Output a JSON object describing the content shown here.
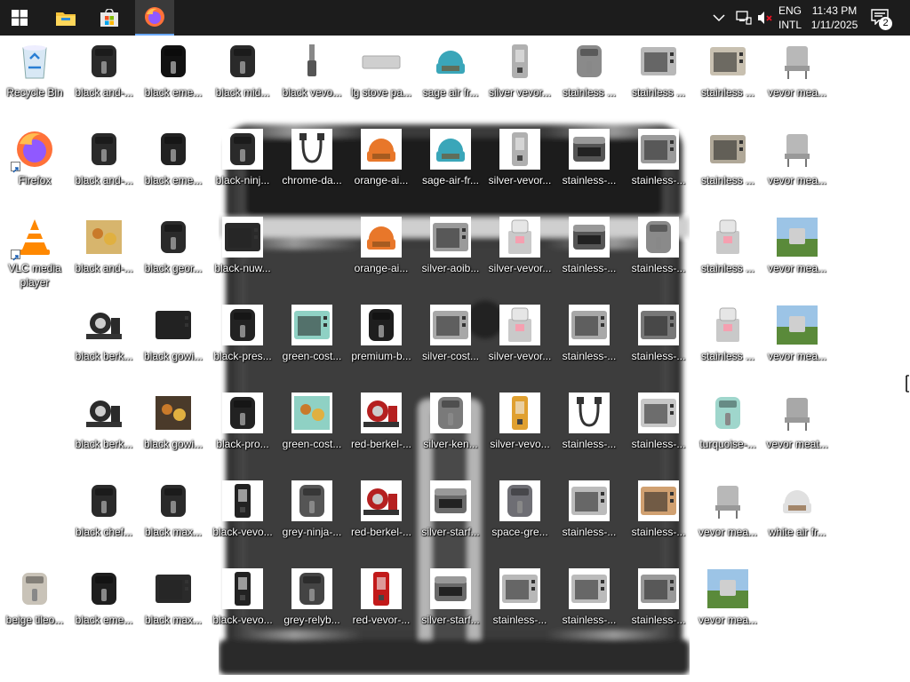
{
  "taskbar": {
    "apps": [
      "start-icon",
      "file-explorer-icon",
      "microsoft-store-icon",
      "firefox-icon"
    ],
    "tray": {
      "lang_top": "ENG",
      "lang_bottom": "INTL",
      "time": "11:43 PM",
      "date": "1/11/2025",
      "notification_count": "2"
    }
  },
  "desktop": {
    "icons": [
      {
        "label": "Recycle Bin",
        "col": 0,
        "row": 0,
        "kind": "bin"
      },
      {
        "label": "Firefox",
        "col": 0,
        "row": 1,
        "kind": "firefox"
      },
      {
        "label": "VLC media player",
        "col": 0,
        "row": 2,
        "kind": "vlc"
      },
      {
        "label": "beige tileo...",
        "col": 0,
        "row": 6,
        "kind": "fryer",
        "color": "#c9c3b8"
      },
      {
        "label": "black and-...",
        "col": 1,
        "row": 0,
        "kind": "fryer",
        "color": "#2a2a2a"
      },
      {
        "label": "black and-...",
        "col": 1,
        "row": 1,
        "kind": "fryer",
        "color": "#2a2a2a"
      },
      {
        "label": "black and-...",
        "col": 1,
        "row": 2,
        "kind": "food",
        "color": "#d7b56d"
      },
      {
        "label": "black berk...",
        "col": 1,
        "row": 3,
        "kind": "slicer",
        "color": "#2a2a2a"
      },
      {
        "label": "black berk...",
        "col": 1,
        "row": 4,
        "kind": "slicer",
        "color": "#2a2a2a"
      },
      {
        "label": "black chef...",
        "col": 1,
        "row": 5,
        "kind": "fryer",
        "color": "#2a2a2a"
      },
      {
        "label": "black eme...",
        "col": 1,
        "row": 6,
        "kind": "fryer",
        "color": "#1e1e1e"
      },
      {
        "label": "black eme...",
        "col": 2,
        "row": 0,
        "kind": "fryer",
        "color": "#111111"
      },
      {
        "label": "black eme...",
        "col": 2,
        "row": 1,
        "kind": "fryer",
        "color": "#222222"
      },
      {
        "label": "black geor...",
        "col": 2,
        "row": 2,
        "kind": "fryer",
        "color": "#2a2a2a"
      },
      {
        "label": "black gowi...",
        "col": 2,
        "row": 3,
        "kind": "oven",
        "color": "#222222"
      },
      {
        "label": "black gowi...",
        "col": 2,
        "row": 4,
        "kind": "food",
        "color": "#4a3a2a"
      },
      {
        "label": "black max...",
        "col": 2,
        "row": 5,
        "kind": "fryer",
        "color": "#2a2a2a"
      },
      {
        "label": "black max...",
        "col": 2,
        "row": 6,
        "kind": "oven",
        "color": "#2a2a2a"
      },
      {
        "label": "black mid...",
        "col": 3,
        "row": 0,
        "kind": "fryer",
        "color": "#2a2a2a"
      },
      {
        "label": "black-ninj...",
        "col": 3,
        "row": 1,
        "kind": "fryer",
        "color": "#2a2a2a"
      },
      {
        "label": "black-nuw...",
        "col": 3,
        "row": 2,
        "kind": "oven",
        "color": "#2a2a2a"
      },
      {
        "label": "black-pres...",
        "col": 3,
        "row": 3,
        "kind": "fryer",
        "color": "#222222"
      },
      {
        "label": "black-pro...",
        "col": 3,
        "row": 4,
        "kind": "fryer",
        "color": "#222222"
      },
      {
        "label": "black-vevo...",
        "col": 3,
        "row": 5,
        "kind": "dispenser",
        "color": "#222222"
      },
      {
        "label": "black-vevo...",
        "col": 3,
        "row": 6,
        "kind": "dispenser",
        "color": "#222222"
      },
      {
        "label": "black vevo...",
        "col": 4,
        "row": 0,
        "kind": "blender",
        "color": "#555555"
      },
      {
        "label": "chrome-da...",
        "col": 4,
        "row": 1,
        "kind": "cable",
        "color": "#333333"
      },
      {
        "label": "green-cost...",
        "col": 4,
        "row": 3,
        "kind": "oven",
        "color": "#8fd1c4"
      },
      {
        "label": "green-cost...",
        "col": 4,
        "row": 4,
        "kind": "food",
        "color": "#8fd1c4"
      },
      {
        "label": "grey-ninja-...",
        "col": 4,
        "row": 5,
        "kind": "fryer",
        "color": "#555555"
      },
      {
        "label": "grey-relyb...",
        "col": 4,
        "row": 6,
        "kind": "fryer",
        "color": "#444444"
      },
      {
        "label": "lg stove pa...",
        "col": 5,
        "row": 0,
        "kind": "tray",
        "color": "#cfcfcf"
      },
      {
        "label": "orange-ai...",
        "col": 5,
        "row": 1,
        "kind": "dome",
        "color": "#e8772a"
      },
      {
        "label": "orange-ai...",
        "col": 5,
        "row": 2,
        "kind": "dome",
        "color": "#e8772a"
      },
      {
        "label": "premium-b...",
        "col": 5,
        "row": 3,
        "kind": "fryer",
        "color": "#1e1e1e"
      },
      {
        "label": "red-berkel-...",
        "col": 5,
        "row": 4,
        "kind": "slicer",
        "color": "#b52020"
      },
      {
        "label": "red-berkel-...",
        "col": 5,
        "row": 5,
        "kind": "slicer",
        "color": "#b52020"
      },
      {
        "label": "red-vevor-...",
        "col": 5,
        "row": 6,
        "kind": "dispenser",
        "color": "#c21a1a"
      },
      {
        "label": "sage air fr...",
        "col": 6,
        "row": 0,
        "kind": "dome",
        "color": "#3aa6b9"
      },
      {
        "label": "sage-air-fr...",
        "col": 6,
        "row": 1,
        "kind": "dome",
        "color": "#3aa6b9"
      },
      {
        "label": "silver-aoib...",
        "col": 6,
        "row": 2,
        "kind": "oven",
        "color": "#9a9a9a"
      },
      {
        "label": "silver-cost...",
        "col": 6,
        "row": 3,
        "kind": "oven",
        "color": "#a8a8a8"
      },
      {
        "label": "silver-ken...",
        "col": 6,
        "row": 4,
        "kind": "fryer",
        "color": "#7a7a7a"
      },
      {
        "label": "silver-starf...",
        "col": 6,
        "row": 5,
        "kind": "grill",
        "color": "#6a6a6a"
      },
      {
        "label": "silver-starf...",
        "col": 6,
        "row": 6,
        "kind": "grill",
        "color": "#6a6a6a"
      },
      {
        "label": "silver vevor...",
        "col": 7,
        "row": 0,
        "kind": "dispenser",
        "color": "#b0b0b0"
      },
      {
        "label": "silver-vevor...",
        "col": 7,
        "row": 1,
        "kind": "dispenser",
        "color": "#b0b0b0"
      },
      {
        "label": "silver-vevor...",
        "col": 7,
        "row": 2,
        "kind": "icecream",
        "color": "#c9c9c9"
      },
      {
        "label": "silver-vevor...",
        "col": 7,
        "row": 3,
        "kind": "icecream",
        "color": "#c9c9c9"
      },
      {
        "label": "silver-vevo...",
        "col": 7,
        "row": 4,
        "kind": "dispenser",
        "color": "#e0a030"
      },
      {
        "label": "space-gre...",
        "col": 7,
        "row": 5,
        "kind": "fryer",
        "color": "#6e6e74"
      },
      {
        "label": "stainless-...",
        "col": 7,
        "row": 6,
        "kind": "oven",
        "color": "#b8b8b8"
      },
      {
        "label": "stainless ...",
        "col": 8,
        "row": 0,
        "kind": "fryer",
        "color": "#8a8a8a"
      },
      {
        "label": "stainless-...",
        "col": 8,
        "row": 1,
        "kind": "grill",
        "color": "#555555"
      },
      {
        "label": "stainless-...",
        "col": 8,
        "row": 2,
        "kind": "grill",
        "color": "#555555"
      },
      {
        "label": "stainless-...",
        "col": 8,
        "row": 3,
        "kind": "oven",
        "color": "#a8a8a8"
      },
      {
        "label": "stainless-...",
        "col": 8,
        "row": 4,
        "kind": "cable",
        "color": "#333333"
      },
      {
        "label": "stainless-...",
        "col": 8,
        "row": 5,
        "kind": "oven",
        "color": "#bbbbbb"
      },
      {
        "label": "stainless-...",
        "col": 8,
        "row": 6,
        "kind": "oven",
        "color": "#bbbbbb"
      },
      {
        "label": "stainless ...",
        "col": 9,
        "row": 0,
        "kind": "oven",
        "color": "#b8b8b8"
      },
      {
        "label": "stainless-...",
        "col": 9,
        "row": 1,
        "kind": "oven",
        "color": "#9a9a9a"
      },
      {
        "label": "stainless-...",
        "col": 9,
        "row": 2,
        "kind": "fryer",
        "color": "#8a8a8a"
      },
      {
        "label": "stainless-...",
        "col": 9,
        "row": 3,
        "kind": "oven",
        "color": "#777777"
      },
      {
        "label": "stainless-...",
        "col": 9,
        "row": 4,
        "kind": "oven",
        "color": "#c8c8c8"
      },
      {
        "label": "stainless-...",
        "col": 9,
        "row": 5,
        "kind": "oven",
        "color": "#d0a070"
      },
      {
        "label": "stainless-...",
        "col": 9,
        "row": 6,
        "kind": "oven",
        "color": "#999999"
      },
      {
        "label": "stainless ...",
        "col": 10,
        "row": 0,
        "kind": "oven",
        "color": "#c8c0b0"
      },
      {
        "label": "stainless ...",
        "col": 10,
        "row": 1,
        "kind": "oven",
        "color": "#b0a898"
      },
      {
        "label": "stainless ...",
        "col": 10,
        "row": 2,
        "kind": "icecream",
        "color": "#c9c9c9"
      },
      {
        "label": "stainless ...",
        "col": 10,
        "row": 3,
        "kind": "icecream",
        "color": "#c9c9c9"
      },
      {
        "label": "turquoise-...",
        "col": 10,
        "row": 4,
        "kind": "fryer",
        "color": "#9fd6cc"
      },
      {
        "label": "vevor mea...",
        "col": 10,
        "row": 5,
        "kind": "drum",
        "color": "#b8b8b8"
      },
      {
        "label": "vevor mea...",
        "col": 10,
        "row": 6,
        "kind": "grass",
        "color": "#5a8a3a"
      },
      {
        "label": "vevor mea...",
        "col": 11,
        "row": 0,
        "kind": "drum",
        "color": "#b8b8b8"
      },
      {
        "label": "vevor mea...",
        "col": 11,
        "row": 1,
        "kind": "drum",
        "color": "#b8b8b8"
      },
      {
        "label": "vevor mea...",
        "col": 11,
        "row": 2,
        "kind": "grass",
        "color": "#5a8a3a"
      },
      {
        "label": "vevor mea...",
        "col": 11,
        "row": 3,
        "kind": "grass",
        "color": "#5a8a3a"
      },
      {
        "label": "vevor meat...",
        "col": 11,
        "row": 4,
        "kind": "drum",
        "color": "#a8a8a8"
      },
      {
        "label": "white air fr...",
        "col": 11,
        "row": 5,
        "kind": "dome",
        "color": "#e0e0e0"
      }
    ]
  }
}
